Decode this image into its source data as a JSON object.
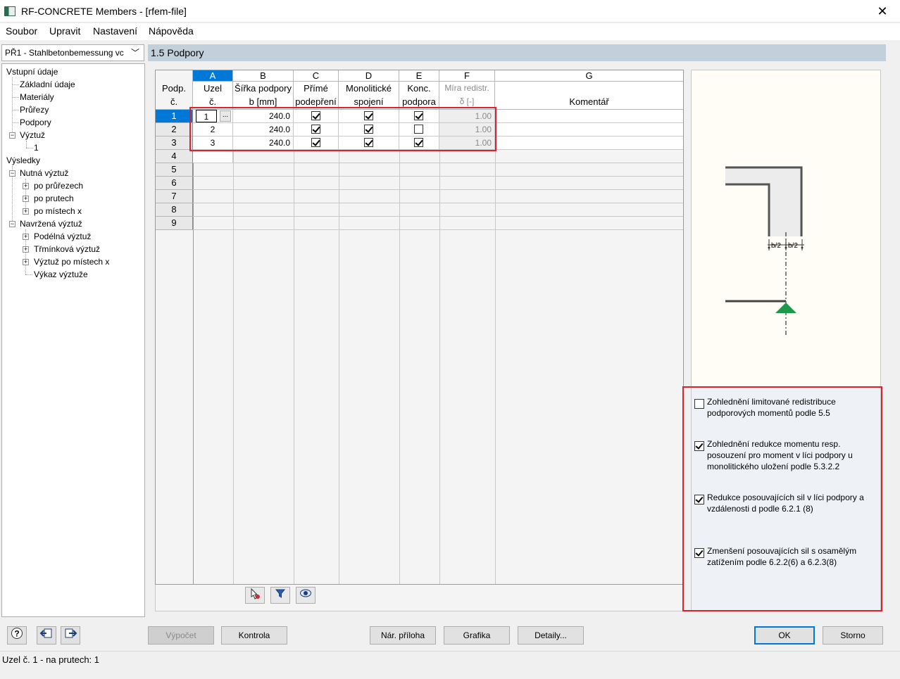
{
  "window": {
    "title": "RF-CONCRETE Members - [rfem-file]"
  },
  "menu": [
    "Soubor",
    "Upravit",
    "Nastavení",
    "Nápověda"
  ],
  "case_select": {
    "value": "PŘ1 - Stahlbetonbemessung vc"
  },
  "tree": {
    "input_root": "Vstupní údaje",
    "basic": "Základní údaje",
    "materials": "Materiály",
    "sections": "Průřezy",
    "supports": "Podpory",
    "reinforcement": "Výztuž",
    "reinforcement_1": "1",
    "results_root": "Výsledky",
    "required_reinf": "Nutná výztuž",
    "by_sections": "po průřezech",
    "by_members": "po prutech",
    "by_location": "po místech x",
    "provided_reinf": "Navržená výztuž",
    "longitudinal": "Podélná výztuž",
    "stirrup": "Třmínková výztuž",
    "reinf_by_location": "Výztuž po místech x",
    "schedule": "Výkaz výztuže"
  },
  "section_title": "1.5 Podpory",
  "table": {
    "rowhdr_label1": "Podp.",
    "rowhdr_label2": "č.",
    "cols": {
      "A": {
        "letter": "A",
        "l1": "Uzel",
        "l2": "č."
      },
      "B": {
        "letter": "B",
        "l1": "Šířka podpory",
        "l2": "b [mm]"
      },
      "C": {
        "letter": "C",
        "l1": "Přímé",
        "l2": "podepření"
      },
      "D": {
        "letter": "D",
        "l1": "Monolitické",
        "l2": "spojení"
      },
      "E": {
        "letter": "E",
        "l1": "Konc.",
        "l2": "podpora"
      },
      "F": {
        "letter": "F",
        "l1": "Míra redistr.",
        "l2": "δ [-]"
      },
      "G": {
        "letter": "G",
        "l1": "",
        "l2": "Komentář"
      }
    },
    "row_numbers": [
      "1",
      "2",
      "3",
      "4",
      "5",
      "6",
      "7",
      "8",
      "9"
    ],
    "rows": [
      {
        "node": "1",
        "width": "240.0",
        "direct": true,
        "monolithic": true,
        "end": true,
        "redistr": "1.00"
      },
      {
        "node": "2",
        "width": "240.0",
        "direct": true,
        "monolithic": true,
        "end": false,
        "redistr": "1.00"
      },
      {
        "node": "3",
        "width": "240.0",
        "direct": true,
        "monolithic": true,
        "end": true,
        "redistr": "1.00"
      }
    ],
    "ellipsis": "..."
  },
  "figure": {
    "half_width_left": "b/2",
    "half_width_right": "b/2",
    "support_color": "#1a9a4a"
  },
  "options": [
    {
      "checked": false,
      "text": "Zohlednění limitované redistribuce podporových momentů podle 5.5"
    },
    {
      "checked": true,
      "text": "Zohlednění redukce momentu resp. posouzení pro moment v líci podpory u monolitického uložení podle 5.3.2.2"
    },
    {
      "checked": true,
      "text": "Redukce posouvajících sil v líci podpory a vzdálenosti d podle 6.2.1 (8)"
    },
    {
      "checked": true,
      "text": "Zmenšení posouvajících sil s osamělým zatížením podle 6.2.2(6) a 6.2.3(8)"
    }
  ],
  "buttons": {
    "calculate": "Výpočet",
    "check": "Kontrola",
    "annex": "Nár. příloha",
    "graphics": "Grafika",
    "details": "Detaily...",
    "ok": "OK",
    "cancel": "Storno"
  },
  "status": "Uzel č. 1  -  na prutech: 1",
  "accent_color": "#0078d7",
  "highlight_color": "#e0202e"
}
